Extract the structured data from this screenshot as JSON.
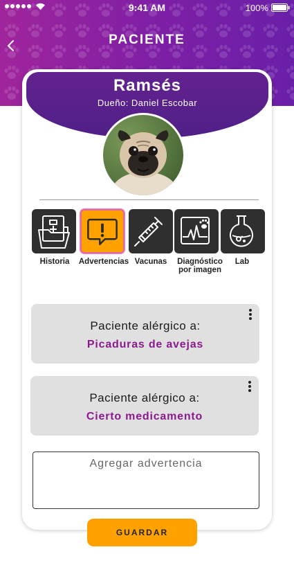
{
  "status_bar": {
    "time": "9:41 AM",
    "battery": "100%"
  },
  "header": {
    "title": "PACIENTE"
  },
  "patient": {
    "name": "Ramsés",
    "owner": "Dueño: Daniel Escobar"
  },
  "tabs": [
    {
      "label": "Historia",
      "icon": "medical-folder-icon",
      "active": false
    },
    {
      "label": "Advertencias",
      "icon": "alert-message-icon",
      "active": true
    },
    {
      "label": "Vacunas",
      "icon": "syringe-icon",
      "active": false
    },
    {
      "label": "Diagnóstico por imagen",
      "icon": "paw-xray-icon",
      "active": false
    },
    {
      "label": "Lab",
      "icon": "flask-icon",
      "active": false
    }
  ],
  "warnings": [
    {
      "title": "Paciente alérgico a:",
      "value": "Picaduras de avejas"
    },
    {
      "title": "Paciente alérgico a:",
      "value": "Cierto medicamento"
    }
  ],
  "add_warning": {
    "placeholder": "Agregar advertencia"
  },
  "save_label": "GUARDAR",
  "colors": {
    "primary": "#8a1fa0",
    "accent": "#ffa200",
    "dark_tile": "#2f2f2f"
  }
}
